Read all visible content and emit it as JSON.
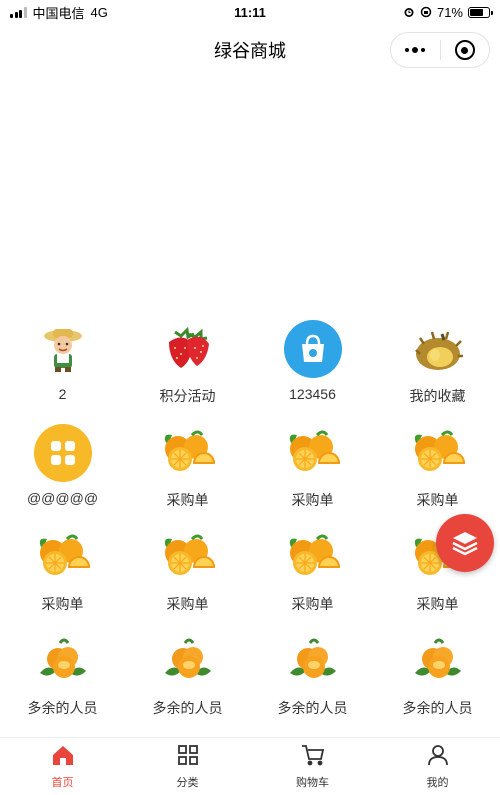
{
  "status_bar": {
    "carrier": "中国电信",
    "network": "4G",
    "time": "11:11",
    "battery_percent": "71%",
    "battery_level": 0.71
  },
  "nav": {
    "title": "绿谷商城"
  },
  "grid": [
    {
      "label": "2",
      "icon": "farmer-icon"
    },
    {
      "label": "积分活动",
      "icon": "strawberry-icon"
    },
    {
      "label": "123456",
      "icon": "shopping-bag-icon"
    },
    {
      "label": "我的收藏",
      "icon": "durian-icon"
    },
    {
      "label": "@@@@@",
      "icon": "apps-grid-icon"
    },
    {
      "label": "采购单",
      "icon": "orange-icon"
    },
    {
      "label": "采购单",
      "icon": "orange-icon"
    },
    {
      "label": "采购单",
      "icon": "orange-icon"
    },
    {
      "label": "采购单",
      "icon": "orange-icon"
    },
    {
      "label": "采购单",
      "icon": "orange-icon"
    },
    {
      "label": "采购单",
      "icon": "orange-icon"
    },
    {
      "label": "采购单",
      "icon": "orange-icon"
    },
    {
      "label": "多余的人员",
      "icon": "mandarin-icon"
    },
    {
      "label": "多余的人员",
      "icon": "mandarin-icon"
    },
    {
      "label": "多余的人员",
      "icon": "mandarin-icon"
    },
    {
      "label": "多余的人员",
      "icon": "mandarin-icon"
    }
  ],
  "tabs": [
    {
      "label": "首页",
      "icon": "home-icon",
      "active": true
    },
    {
      "label": "分类",
      "icon": "category-icon",
      "active": false
    },
    {
      "label": "购物车",
      "icon": "cart-icon",
      "active": false
    },
    {
      "label": "我的",
      "icon": "profile-icon",
      "active": false
    }
  ],
  "colors": {
    "accent": "#e8453c",
    "fab": "#e8453c",
    "bag_blue": "#2fa4e7",
    "apps_yellow": "#f7b928"
  }
}
